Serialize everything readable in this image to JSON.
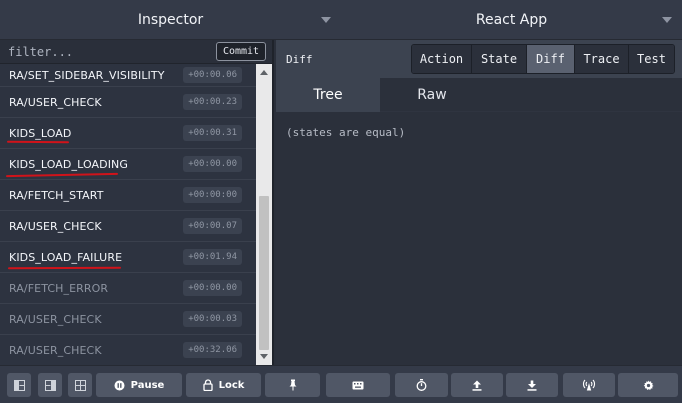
{
  "topbar": {
    "inspector_label": "Inspector",
    "app_label": "React App"
  },
  "left": {
    "filter_placeholder": "filter...",
    "commit_label": "Commit",
    "actions": [
      {
        "name": "RA/SET_SIDEBAR_VISIBILITY",
        "time": "+00:00.06",
        "dim": false,
        "underlined": false
      },
      {
        "name": "RA/USER_CHECK",
        "time": "+00:00.23",
        "dim": false,
        "underlined": false
      },
      {
        "name": "KIDS_LOAD",
        "time": "+00:00.31",
        "dim": false,
        "underlined": true
      },
      {
        "name": "KIDS_LOAD_LOADING",
        "time": "+00:00.00",
        "dim": false,
        "underlined": true
      },
      {
        "name": "RA/FETCH_START",
        "time": "+00:00:00",
        "dim": false,
        "underlined": false
      },
      {
        "name": "RA/USER_CHECK",
        "time": "+00:00.07",
        "dim": false,
        "underlined": false
      },
      {
        "name": "KIDS_LOAD_FAILURE",
        "time": "+00:01.94",
        "dim": false,
        "underlined": true
      },
      {
        "name": "RA/FETCH_ERROR",
        "time": "+00:00.00",
        "dim": true,
        "underlined": false
      },
      {
        "name": "RA/USER_CHECK",
        "time": "+00:00.03",
        "dim": true,
        "underlined": false
      },
      {
        "name": "RA/USER_CHECK",
        "time": "+00:32.06",
        "dim": true,
        "underlined": false
      }
    ]
  },
  "right": {
    "title": "Diff",
    "tabs": [
      {
        "label": "Action",
        "active": false
      },
      {
        "label": "State",
        "active": false
      },
      {
        "label": "Diff",
        "active": true
      },
      {
        "label": "Trace",
        "active": false
      },
      {
        "label": "Test",
        "active": false
      }
    ],
    "subtabs": [
      {
        "label": "Tree",
        "active": true
      },
      {
        "label": "Raw",
        "active": false
      }
    ],
    "message": "(states are equal)"
  },
  "bottombar": {
    "pause_label": "Pause",
    "lock_label": "Lock",
    "icons": [
      "layout-left-icon",
      "layout-right-icon",
      "layout-bottom-icon",
      "pause-icon",
      "lock-icon",
      "pin-icon",
      "keyboard-icon",
      "stopwatch-icon",
      "upload-icon",
      "download-icon",
      "remote-icon",
      "gear-icon"
    ]
  },
  "colors": {
    "underline": "#d0131a",
    "active_tab": "#5a6170"
  }
}
